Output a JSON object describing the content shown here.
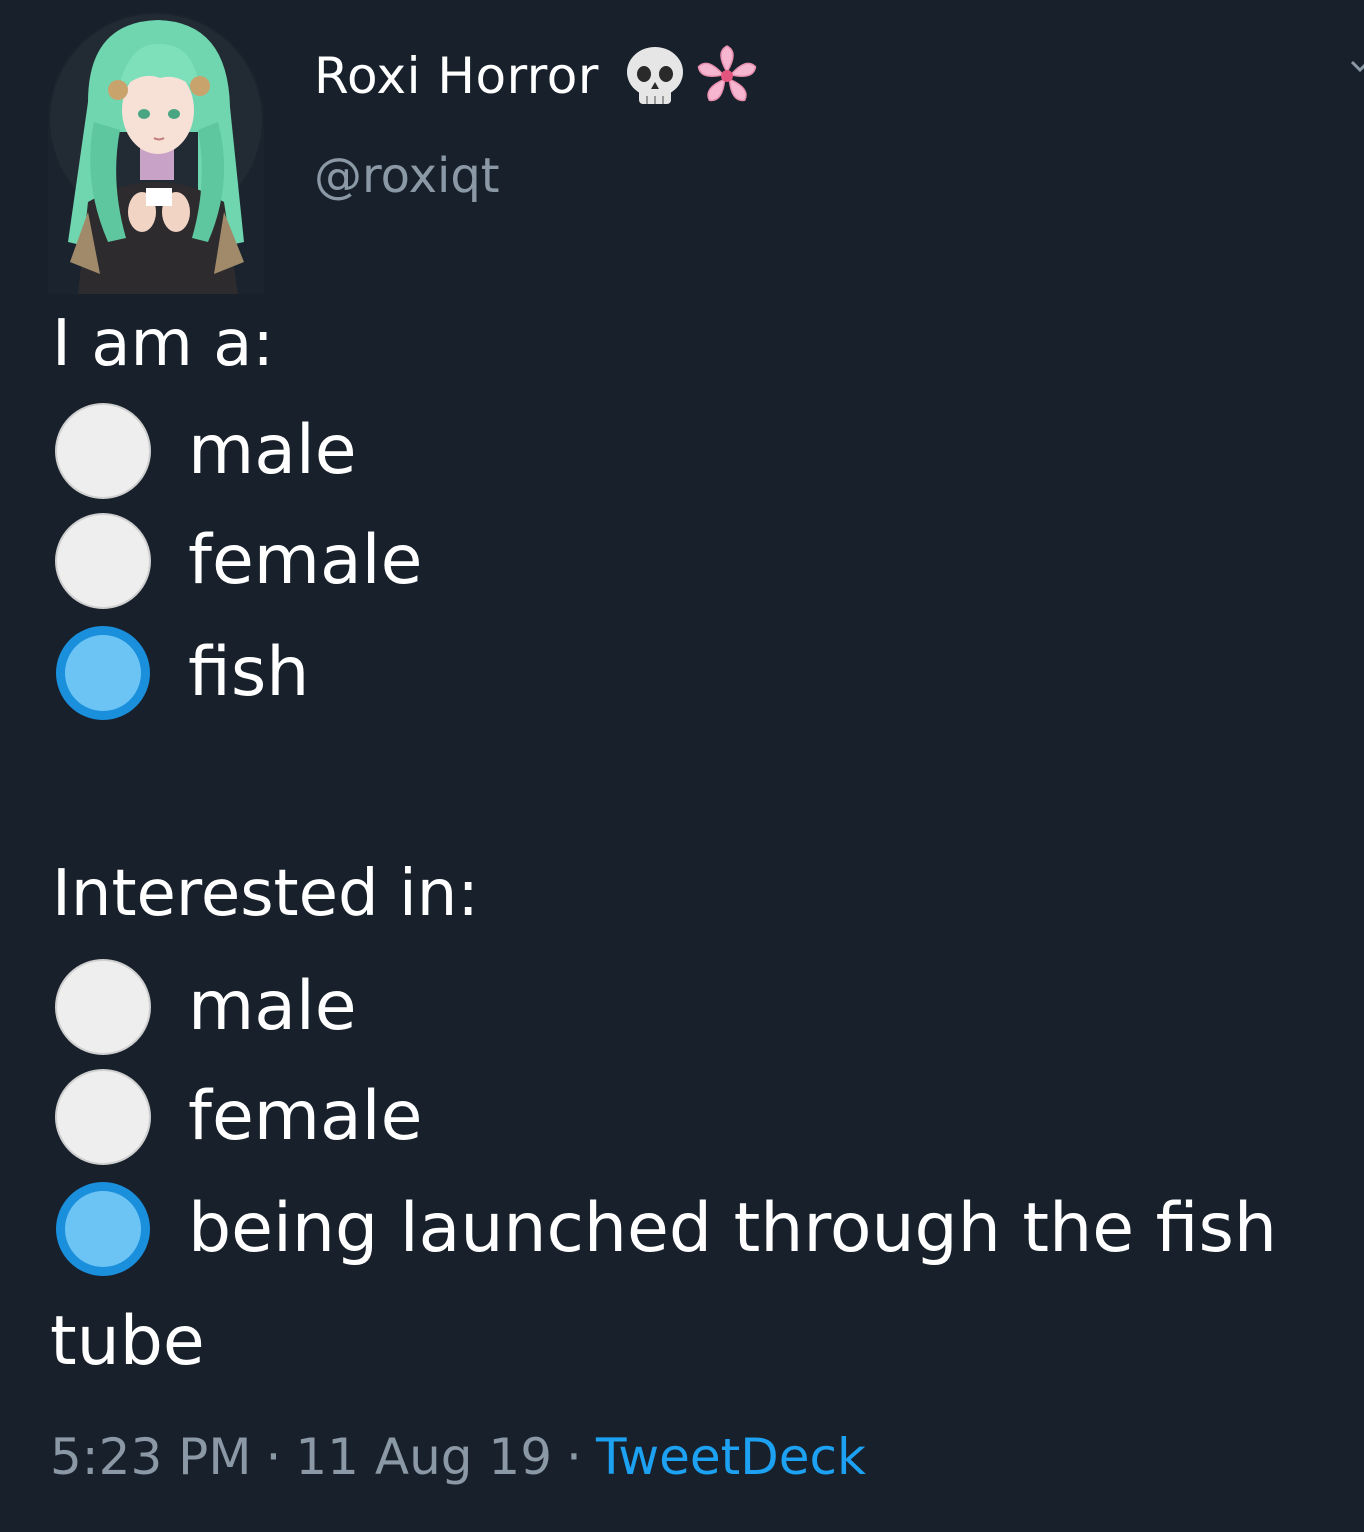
{
  "author": {
    "display_name": "Roxi Horror",
    "handle": "@roxiqt",
    "emoji": [
      "skull-emoji",
      "cherry-blossom-emoji"
    ]
  },
  "tweet": {
    "section1": {
      "heading": "I am a:",
      "options": [
        {
          "label": "male",
          "selected": false
        },
        {
          "label": "female",
          "selected": false
        },
        {
          "label": "fish",
          "selected": true
        }
      ]
    },
    "section2": {
      "heading": "Interested in:",
      "options": [
        {
          "label": "male",
          "selected": false
        },
        {
          "label": "female",
          "selected": false
        },
        {
          "label": "being launched through the fish",
          "selected": true
        }
      ],
      "wrap_continuation": "tube"
    }
  },
  "meta": {
    "time": "5:23 PM",
    "date": "11 Aug 19",
    "separator": "·",
    "source": "TweetDeck"
  },
  "colors": {
    "background": "#17202b",
    "text": "#ffffff",
    "muted": "#8b98a5",
    "accent": "#1da1f2",
    "radio_selected": "#55b8f0",
    "radio_unselected": "#eeeeee"
  }
}
